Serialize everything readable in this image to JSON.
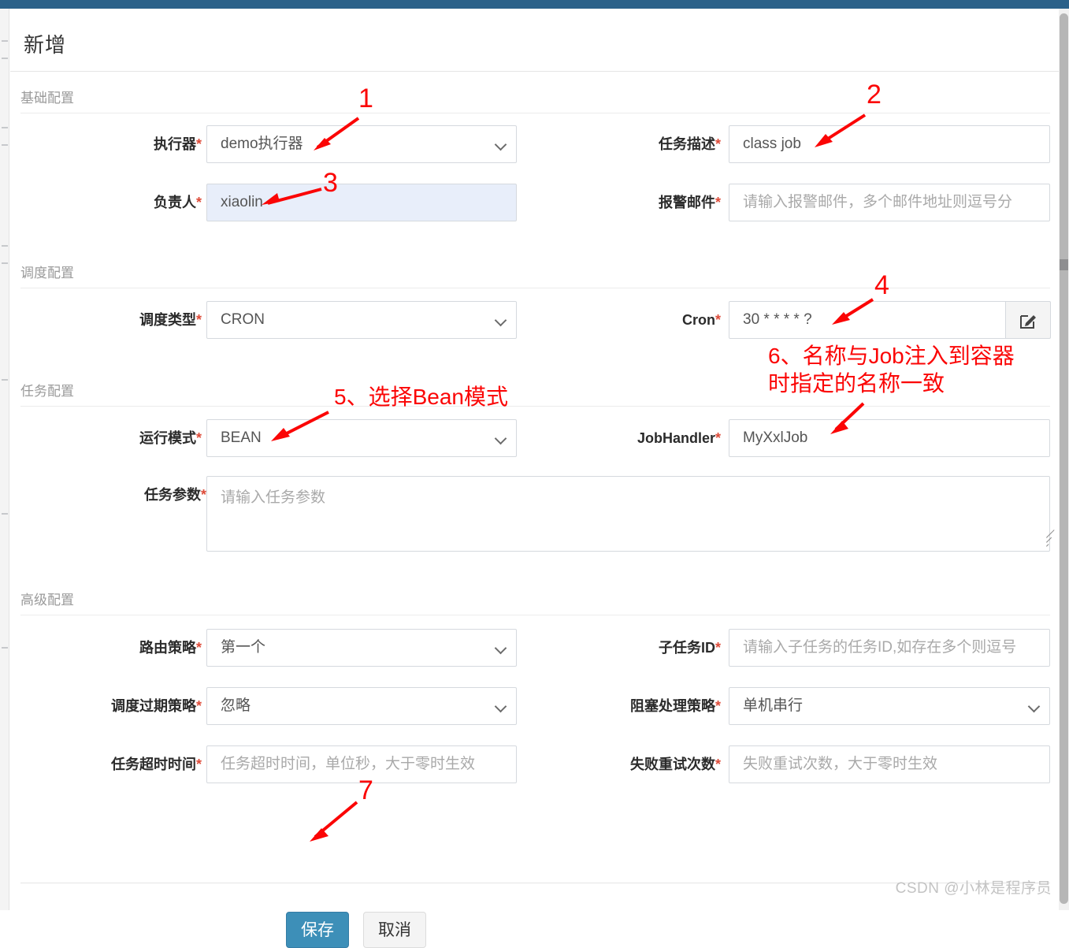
{
  "window": {
    "title": "新增",
    "topbar_color": "#2b6189"
  },
  "sections": {
    "basic": {
      "title": "基础配置"
    },
    "schedule": {
      "title": "调度配置"
    },
    "task": {
      "title": "任务配置"
    },
    "advanced": {
      "title": "高级配置"
    }
  },
  "fields": {
    "executor": {
      "label": "执行器",
      "required": "*",
      "value": "demo执行器",
      "type": "select"
    },
    "job_desc": {
      "label": "任务描述",
      "required": "*",
      "value": "class job",
      "type": "text"
    },
    "owner": {
      "label": "负责人",
      "required": "*",
      "value": "xiaolin",
      "type": "text"
    },
    "alarm_email": {
      "label": "报警邮件",
      "required": "*",
      "placeholder": "请输入报警邮件，多个邮件地址则逗号分",
      "type": "text"
    },
    "schedule_type": {
      "label": "调度类型",
      "required": "*",
      "value": "CRON",
      "type": "select"
    },
    "cron": {
      "label": "Cron",
      "required": "*",
      "value": "30 * * * * ?",
      "type": "text",
      "addon_icon": "edit-icon"
    },
    "run_mode": {
      "label": "运行模式",
      "required": "*",
      "value": "BEAN",
      "type": "select"
    },
    "job_handler": {
      "label": "JobHandler",
      "required": "*",
      "value": "MyXxlJob",
      "type": "text"
    },
    "job_param": {
      "label": "任务参数",
      "required": "*",
      "placeholder": "请输入任务参数",
      "type": "textarea"
    },
    "route_strategy": {
      "label": "路由策略",
      "required": "*",
      "value": "第一个",
      "type": "select"
    },
    "child_job_id": {
      "label": "子任务ID",
      "required": "*",
      "placeholder": "请输入子任务的任务ID,如存在多个则逗号",
      "type": "text"
    },
    "misfire": {
      "label": "调度过期策略",
      "required": "*",
      "value": "忽略",
      "type": "select"
    },
    "block_strategy": {
      "label": "阻塞处理策略",
      "required": "*",
      "value": "单机串行",
      "type": "select"
    },
    "timeout": {
      "label": "任务超时时间",
      "required": "*",
      "placeholder": "任务超时时间，单位秒，大于零时生效",
      "type": "text"
    },
    "retry_count": {
      "label": "失败重试次数",
      "required": "*",
      "placeholder": "失败重试次数，大于零时生效",
      "type": "text"
    }
  },
  "footer": {
    "save_label": "保存",
    "cancel_label": "取消",
    "save_color": "#3d8fb8"
  },
  "watermark": "CSDN @小林是程序员",
  "annotations": {
    "color": "#fb0505",
    "n1": "1",
    "n2": "2",
    "n3": "3",
    "n4": "4",
    "n5": "5、选择Bean模式",
    "n6_line1": "6、名称与Job注入到容器",
    "n6_line2": "时指定的名称一致",
    "n7": "7"
  }
}
